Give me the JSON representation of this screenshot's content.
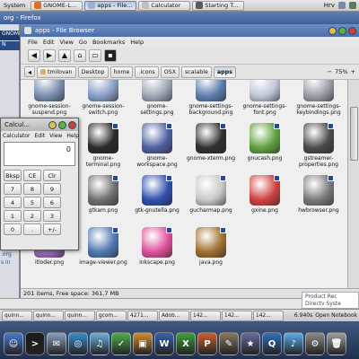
{
  "top_panel": {
    "system_menu": "System",
    "tasks": [
      {
        "label": "GNOME-L...",
        "color": "#e07020",
        "active": false
      },
      {
        "label": "apps - File...",
        "color": "#9ab0d8",
        "active": true
      },
      {
        "label": "Calculator",
        "color": "#c0c0c0",
        "active": false
      },
      {
        "label": "Starting T...",
        "color": "#5a5a5a",
        "active": false
      }
    ],
    "keyboard_layout": "Hrv"
  },
  "firefox": {
    "title_fragment": "org - Firefox",
    "tab_fragment": "GNOME-Lo",
    "side_letter": "N",
    "links": [
      ".org",
      ".org",
      "s in"
    ]
  },
  "file_browser": {
    "title": "apps - File Browser",
    "menu": [
      "File",
      "Edit",
      "View",
      "Go",
      "Bookmarks",
      "Help"
    ],
    "path": [
      "tmilovan",
      "Desktop",
      "home",
      ".icons",
      "OSX",
      "scalable",
      "apps"
    ],
    "zoom": "75%",
    "items": [
      {
        "label": "gnome-session-suspend.png",
        "color": "#7a8fb0"
      },
      {
        "label": "gnome-session-switch.png",
        "color": "#8aa0c8"
      },
      {
        "label": "gnome-settings.png",
        "color": "#a0a8b8"
      },
      {
        "label": "gnome-settings-background.png",
        "color": "#6080b0"
      },
      {
        "label": "gnome-settings-font.png",
        "color": "#c0c8d8"
      },
      {
        "label": "gnome-settings-keybindings.png",
        "color": "#9aa0aa"
      },
      {
        "label": "gnome-settings-theme.png",
        "color": "#e07820"
      },
      {
        "label": "gnome-terminal.png",
        "color": "#2a2a2a"
      },
      {
        "label": "gnome-workspace.png",
        "color": "#5060a0"
      },
      {
        "label": "gnome-xterm.png",
        "color": "#303030"
      },
      {
        "label": "gnucash.png",
        "color": "#60a040"
      },
      {
        "label": "gstreamer-properties.png",
        "color": "#4a4a4a"
      },
      {
        "label": "gthumb.png",
        "color": "#3a70c8"
      },
      {
        "label": "gtkam.png",
        "color": "#707070"
      },
      {
        "label": "gtk-gnutella.png",
        "color": "#3050b0"
      },
      {
        "label": "gucharmap.png",
        "color": "#c8c8c8"
      },
      {
        "label": "gxine.png",
        "color": "#d04040"
      },
      {
        "label": "hwbrowser.png",
        "color": "#7a7a7a"
      },
      {
        "label": "itloder.png",
        "color": "#a070c0"
      },
      {
        "label": "image-viewer.png",
        "color": "#5078b0"
      },
      {
        "label": "inkscape.png",
        "color": "#e0509a"
      },
      {
        "label": "java.png",
        "color": "#a07030"
      }
    ],
    "status": "201 items, Free space: 361,7 MB"
  },
  "calculator": {
    "title": "Calcul...",
    "menu": [
      "Calculator",
      "Edit",
      "View",
      "Help"
    ],
    "display": "0",
    "keys": [
      "Bksp",
      "CE",
      "Clr",
      "7",
      "8",
      "9",
      "4",
      "5",
      "6",
      "1",
      "2",
      "3",
      "0",
      ".",
      "+/-"
    ]
  },
  "taskbar": {
    "tasks": [
      "quinn...",
      "quinn...",
      "quinn...",
      "gcom...",
      "4271...",
      "Adob...",
      "142...",
      "142...",
      "142..."
    ],
    "notebook": "Open Notebook",
    "time": "6.940s"
  },
  "product_box": [
    "Product Rec",
    "Directv Syste"
  ],
  "dock": {
    "icons": [
      {
        "name": "finder",
        "color": "#4a7ad0",
        "glyph": "☺"
      },
      {
        "name": "terminal",
        "color": "#1a1a1a",
        "glyph": ">"
      },
      {
        "name": "mail",
        "color": "#8aa0c0",
        "glyph": "✉"
      },
      {
        "name": "safari",
        "color": "#3a90d0",
        "glyph": "◎"
      },
      {
        "name": "itunes",
        "color": "#6fb0e0",
        "glyph": "♫"
      },
      {
        "name": "ichat",
        "color": "#50b050",
        "glyph": "✓"
      },
      {
        "name": "iphoto",
        "color": "#d09030",
        "glyph": "▣"
      },
      {
        "name": "word",
        "color": "#3a60b0",
        "glyph": "W"
      },
      {
        "name": "excel",
        "color": "#40a040",
        "glyph": "X"
      },
      {
        "name": "powerpoint",
        "color": "#d06030",
        "glyph": "P"
      },
      {
        "name": "gimp",
        "color": "#8a7a60",
        "glyph": "✎"
      },
      {
        "name": "imovie",
        "color": "#6a6aa0",
        "glyph": "★"
      },
      {
        "name": "quicktime",
        "color": "#3070c0",
        "glyph": "Q"
      },
      {
        "name": "itunes2",
        "color": "#5ab0f0",
        "glyph": "♪"
      },
      {
        "name": "settings",
        "color": "#8a8a8a",
        "glyph": "⚙"
      },
      {
        "name": "trash",
        "color": "#a0a0a0",
        "glyph": "🗑"
      }
    ]
  }
}
